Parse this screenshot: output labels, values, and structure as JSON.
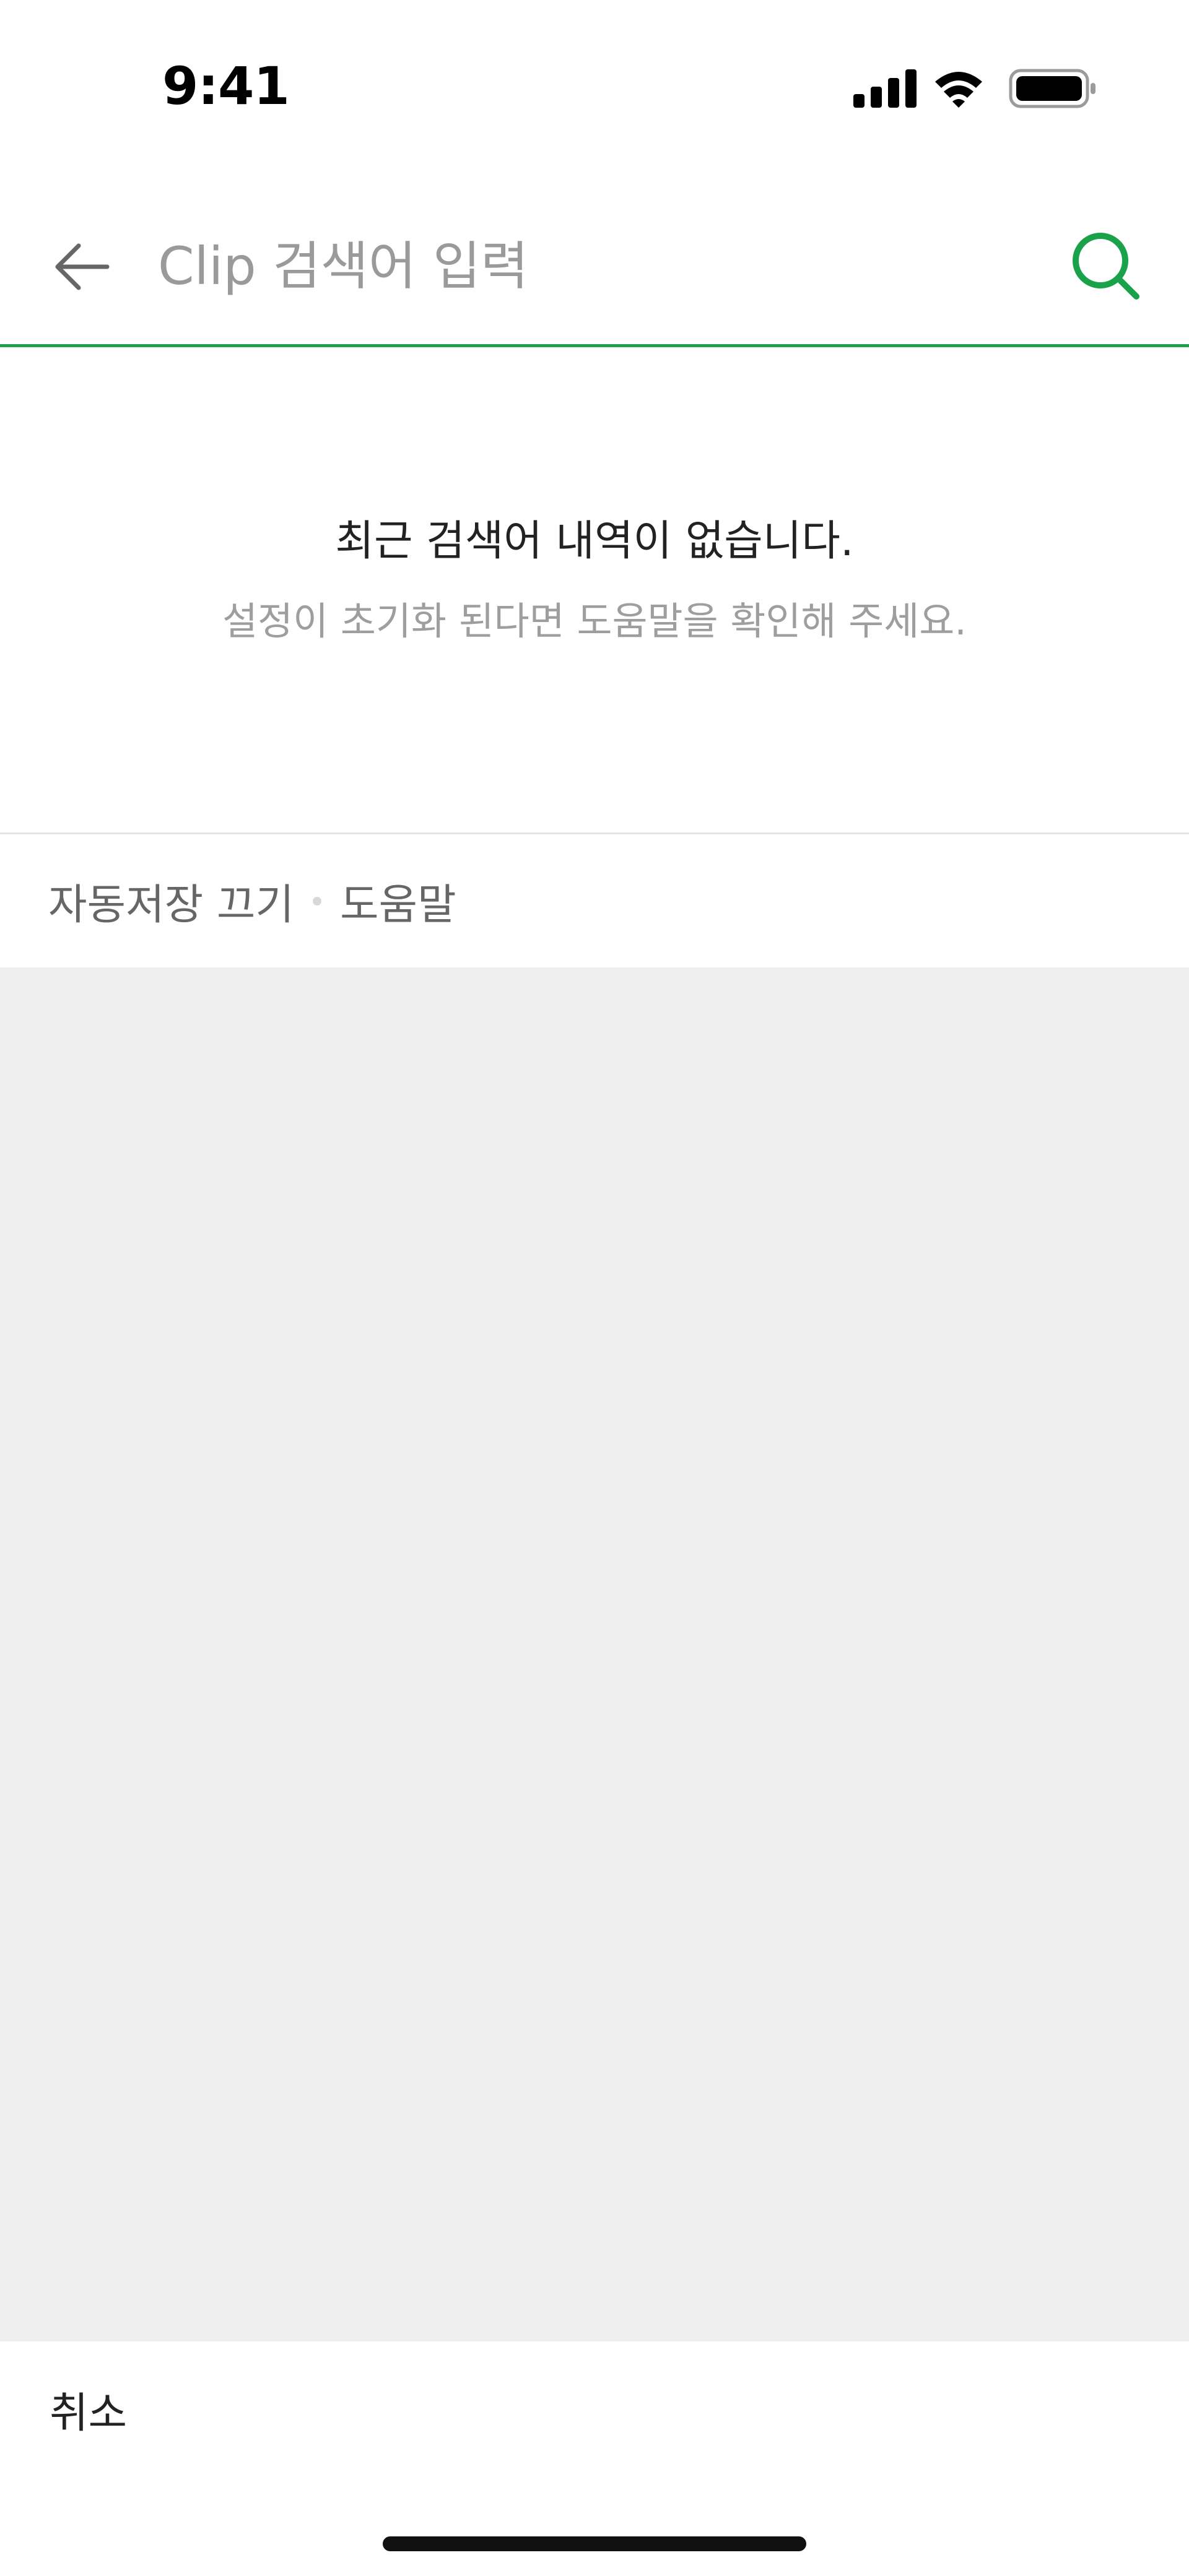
{
  "status_bar": {
    "time": "9:41",
    "icons": [
      "cellular-signal-icon",
      "wifi-icon",
      "battery-icon"
    ]
  },
  "search": {
    "value": "",
    "placeholder": "Clip 검색어 입력",
    "accent_color": "#19a24a",
    "back_icon": "arrow-left-icon",
    "search_icon": "search-icon"
  },
  "empty_state": {
    "title": "최근 검색어 내역이 없습니다.",
    "subtitle": "설정이 초기화 된다면 도움말을 확인해 주세요."
  },
  "options": {
    "autosave_label": "자동저장 끄기",
    "help_label": "도움말"
  },
  "bottom": {
    "cancel_label": "취소"
  }
}
